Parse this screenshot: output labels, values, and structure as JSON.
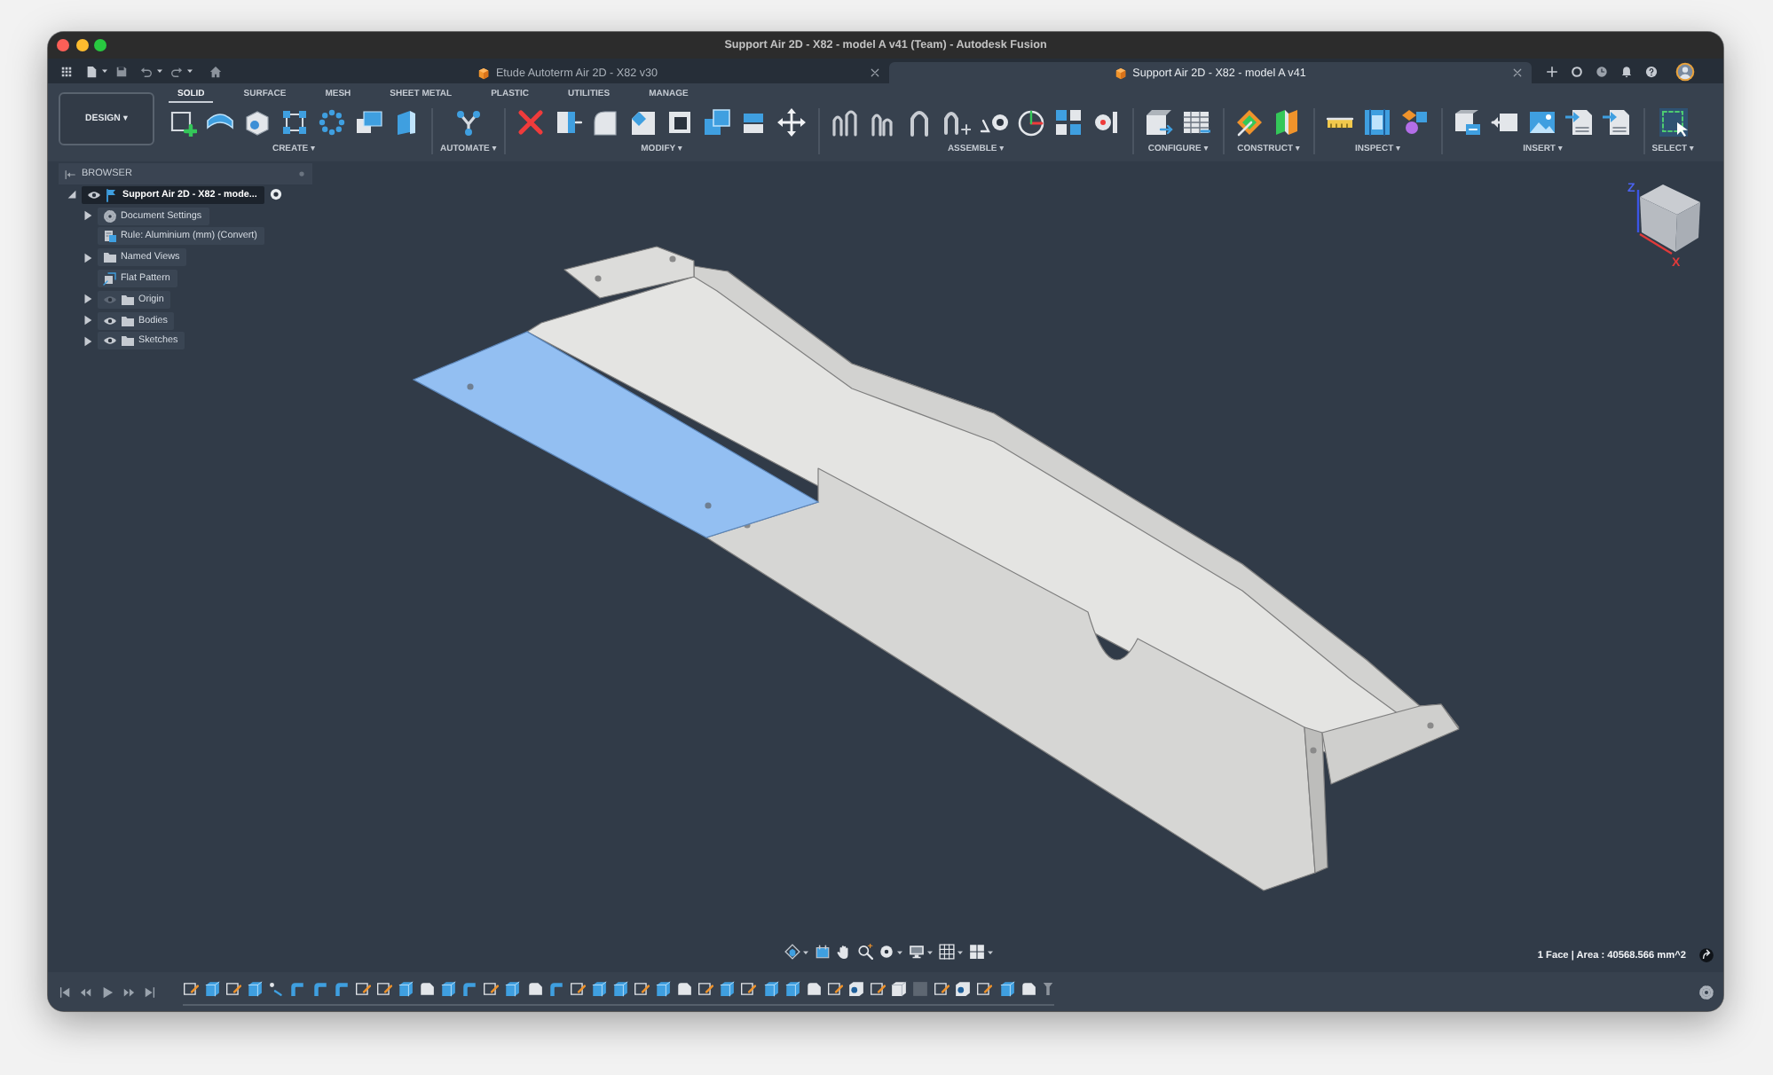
{
  "window": {
    "title": "Support Air 2D - X82 - model A v41 (Team) - Autodesk Fusion"
  },
  "document_tabs": [
    {
      "label": "Etude Autoterm Air 2D - X82 v30",
      "selected": false
    },
    {
      "label": "Support Air 2D - X82 - model A v41",
      "selected": true
    }
  ],
  "workspace": {
    "label": "DESIGN ▾"
  },
  "toolbar_tabs": [
    {
      "label": "SOLID",
      "selected": true
    },
    {
      "label": "SURFACE",
      "selected": false
    },
    {
      "label": "MESH",
      "selected": false
    },
    {
      "label": "SHEET METAL",
      "selected": false
    },
    {
      "label": "PLASTIC",
      "selected": false
    },
    {
      "label": "UTILITIES",
      "selected": false
    },
    {
      "label": "MANAGE",
      "selected": false
    }
  ],
  "toolbar_groups": [
    {
      "label": "CREATE ▾"
    },
    {
      "label": "AUTOMATE ▾"
    },
    {
      "label": "MODIFY ▾"
    },
    {
      "label": "ASSEMBLE ▾"
    },
    {
      "label": "CONFIGURE ▾"
    },
    {
      "label": "CONSTRUCT ▾"
    },
    {
      "label": "INSPECT ▾"
    },
    {
      "label": "INSERT ▾"
    },
    {
      "label": "SELECT ▾"
    }
  ],
  "browser": {
    "title": "BROWSER",
    "items": [
      {
        "label": "Support Air 2D - X82 - mode...",
        "kind": "component",
        "expanded": true,
        "visible": true,
        "selected": true,
        "active": true,
        "children": [
          {
            "label": "Document Settings",
            "kind": "settings",
            "expanded": false,
            "selected": false
          },
          {
            "label": "Rule: Aluminium (mm) (Convert)",
            "kind": "rule",
            "selected": false
          },
          {
            "label": "Named Views",
            "kind": "folder",
            "expanded": false,
            "selected": false
          },
          {
            "label": "Flat Pattern",
            "kind": "flat_pattern",
            "selected": false
          },
          {
            "label": "Origin",
            "kind": "folder",
            "expanded": false,
            "visible": false,
            "selected": false
          },
          {
            "label": "Bodies",
            "kind": "folder",
            "expanded": false,
            "visible": true,
            "selected": false
          },
          {
            "label": "Sketches",
            "kind": "folder",
            "expanded": false,
            "visible": true,
            "selected": false
          }
        ]
      }
    ]
  },
  "view_cube": {
    "z_label": "Z",
    "x_label": "X"
  },
  "status_bar": {
    "selection": "1 Face | Area : 40568.566 mm^2"
  }
}
